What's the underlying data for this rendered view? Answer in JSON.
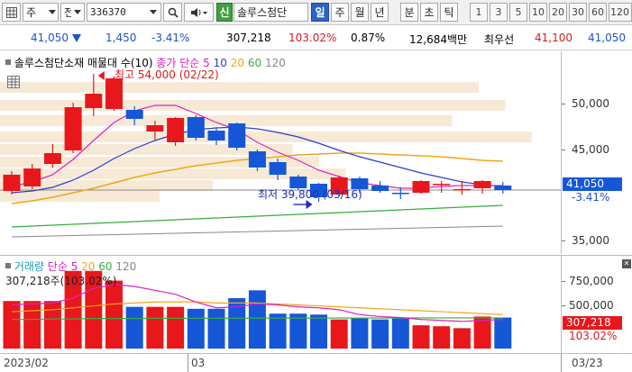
{
  "toolbar": {
    "type_select": "주",
    "mode_select": "전",
    "code_value": "336370",
    "stock_name": "솔루스첨단",
    "sin_label": "신",
    "periods": [
      "일",
      "주",
      "월",
      "년",
      "분",
      "초",
      "틱"
    ],
    "active_period": "일",
    "minutes": [
      "1",
      "3",
      "5",
      "10",
      "20",
      "30",
      "60",
      "120"
    ]
  },
  "info": {
    "price": "41,050",
    "change": "1,450",
    "change_pct": "-3.41%",
    "volume": "307,218",
    "vol_ratio": "103.02%",
    "turnover": "0.87%",
    "amount": "12,684백만",
    "pref_label": "최우선",
    "ask": "41,100",
    "bid": "41,050"
  },
  "price_panel": {
    "title": "솔루스첨단소재 매물대 수(10)",
    "ma_title": "종가 단순",
    "ma_periods": [
      "5",
      "10",
      "20",
      "60",
      "120"
    ],
    "high_label": "최고 54,000 (02/22)",
    "low_label": "최저 39,800 (03/16)",
    "y_ticks": [
      "50,000",
      "45,000",
      "35,000"
    ],
    "current_tag": "41,050",
    "current_change": "-3.41%"
  },
  "volume_panel": {
    "title": "거래량",
    "ma_title": "단순",
    "ma_periods": [
      "5",
      "20",
      "60",
      "120"
    ],
    "current_label": "307,218주(103.02%)",
    "y_ticks": [
      "750,000",
      "500,000"
    ],
    "current_tag": "307,218",
    "current_pct": "103.02%"
  },
  "x_axis": {
    "labels": [
      "2023/02",
      "03",
      "03/23"
    ]
  },
  "colors": {
    "up": "#e8171b",
    "down": "#1657d8",
    "ma5": "#e020c0",
    "ma10": "#2a3ed0",
    "ma20": "#f0a51c",
    "ma60": "#36ad3c",
    "ma120": "#888888",
    "volume_profile": "#f6ead7"
  },
  "chart_data": [
    {
      "type": "candlestick",
      "title": "솔루스첨단소재",
      "ylim": [
        34000,
        56500
      ],
      "y_ticks": [
        35000,
        45000,
        50000
      ],
      "grid": false,
      "candles": [
        {
          "o": 41000,
          "h": 43200,
          "l": 40600,
          "c": 42800
        },
        {
          "o": 41500,
          "h": 44000,
          "l": 41200,
          "c": 43500
        },
        {
          "o": 44000,
          "h": 46200,
          "l": 43600,
          "c": 45200
        },
        {
          "o": 45500,
          "h": 50800,
          "l": 45200,
          "c": 50300
        },
        {
          "o": 50200,
          "h": 54000,
          "l": 49300,
          "c": 51800
        },
        {
          "o": 50100,
          "h": 53700,
          "l": 49900,
          "c": 53500
        },
        {
          "o": 50000,
          "h": 50400,
          "l": 48300,
          "c": 49000
        },
        {
          "o": 47600,
          "h": 48800,
          "l": 46700,
          "c": 48300
        },
        {
          "o": 46400,
          "h": 49200,
          "l": 46000,
          "c": 49100
        },
        {
          "o": 49200,
          "h": 49400,
          "l": 46600,
          "c": 46900
        },
        {
          "o": 47700,
          "h": 48100,
          "l": 46100,
          "c": 46600
        },
        {
          "o": 48500,
          "h": 48600,
          "l": 45500,
          "c": 45800
        },
        {
          "o": 45400,
          "h": 45600,
          "l": 43200,
          "c": 43600
        },
        {
          "o": 44200,
          "h": 44600,
          "l": 42200,
          "c": 42800
        },
        {
          "o": 42600,
          "h": 42800,
          "l": 41100,
          "c": 41300
        },
        {
          "o": 41800,
          "h": 41900,
          "l": 39800,
          "c": 40300
        },
        {
          "o": 40600,
          "h": 42700,
          "l": 40400,
          "c": 42500
        },
        {
          "o": 42400,
          "h": 42600,
          "l": 40800,
          "c": 41200
        },
        {
          "o": 41600,
          "h": 42100,
          "l": 40800,
          "c": 41000
        },
        {
          "o": 40800,
          "h": 41400,
          "l": 40100,
          "c": 40700
        },
        {
          "o": 40800,
          "h": 42200,
          "l": 40700,
          "c": 42100
        },
        {
          "o": 41800,
          "h": 42100,
          "l": 40800,
          "c": 41800
        },
        {
          "o": 41200,
          "h": 42100,
          "l": 40600,
          "c": 41200
        },
        {
          "o": 41300,
          "h": 42200,
          "l": 40700,
          "c": 42100
        },
        {
          "o": 41600,
          "h": 42000,
          "l": 40700,
          "c": 41100
        }
      ],
      "ma5": [
        41500,
        42000,
        42800,
        44500,
        46600,
        48600,
        49900,
        50500,
        50500,
        49600,
        48600,
        47800,
        46400,
        45300,
        44400,
        43300,
        42600,
        41900,
        41600,
        41300,
        41300,
        41500,
        41600,
        41600,
        41600
      ],
      "ma10": [
        40800,
        41000,
        41400,
        42200,
        43300,
        44600,
        45700,
        46600,
        47300,
        47800,
        48000,
        48100,
        47900,
        47500,
        47000,
        46300,
        45500,
        44800,
        44200,
        43600,
        43000,
        42500,
        42000,
        41700,
        41500
      ],
      "ma20": [
        39600,
        39900,
        40300,
        40800,
        41300,
        41900,
        42500,
        43000,
        43400,
        43800,
        44100,
        44400,
        44600,
        44800,
        45000,
        45100,
        45200,
        45200,
        45100,
        45000,
        44900,
        44800,
        44600,
        44400,
        44300
      ],
      "ma60": [
        37000,
        37100,
        37200,
        37300,
        37400,
        37500,
        37600,
        37700,
        37800,
        37900,
        38000,
        38100,
        38200,
        38300,
        38400,
        38500,
        38600,
        38700,
        38800,
        38900,
        39000,
        39100,
        39200,
        39300,
        39400
      ],
      "ma120": [
        35900,
        35950,
        36000,
        36050,
        36100,
        36150,
        36200,
        36250,
        36300,
        36350,
        36400,
        36450,
        36500,
        36550,
        36600,
        36650,
        36700,
        36750,
        36800,
        36850,
        36900,
        36950,
        37000,
        37050,
        37100
      ],
      "volume_profile": [
        {
          "price": 52500,
          "ratio": 0.9
        },
        {
          "price": 50500,
          "ratio": 0.95
        },
        {
          "price": 48800,
          "ratio": 0.85
        },
        {
          "price": 47000,
          "ratio": 1.0
        },
        {
          "price": 45600,
          "ratio": 0.55
        },
        {
          "price": 44200,
          "ratio": 0.6
        },
        {
          "price": 42900,
          "ratio": 0.65
        },
        {
          "price": 41600,
          "ratio": 0.4
        },
        {
          "price": 40400,
          "ratio": 0.3
        }
      ]
    },
    {
      "type": "bar",
      "title": "거래량",
      "ylim": [
        0,
        900000
      ],
      "y_ticks": [
        500000,
        750000
      ],
      "volumes": [
        490000,
        490000,
        490000,
        800000,
        800000,
        700000,
        430000,
        430000,
        430000,
        410000,
        410000,
        520000,
        600000,
        360000,
        360000,
        350000,
        300000,
        310000,
        300000,
        310000,
        240000,
        230000,
        210000,
        330000,
        320000
      ],
      "ma5": [
        450000,
        460000,
        470000,
        520000,
        620000,
        660000,
        640000,
        600000,
        560000,
        480000,
        420000,
        430000,
        460000,
        450000,
        430000,
        420000,
        400000,
        350000,
        330000,
        320000,
        300000,
        290000,
        280000,
        290000,
        300000
      ],
      "ma20": [
        380000,
        390000,
        400000,
        420000,
        440000,
        460000,
        470000,
        480000,
        480000,
        480000,
        470000,
        470000,
        470000,
        460000,
        450000,
        440000,
        430000,
        420000,
        410000,
        400000,
        390000,
        380000,
        370000,
        360000,
        350000
      ],
      "ma60": [
        300000,
        300000,
        305000,
        305000,
        310000,
        310000,
        310000,
        312000,
        312000,
        312000,
        313000,
        313000,
        313000,
        314000,
        314000,
        314000,
        315000,
        315000,
        315000,
        316000,
        316000,
        316000,
        316000,
        316000,
        316000
      ]
    }
  ]
}
